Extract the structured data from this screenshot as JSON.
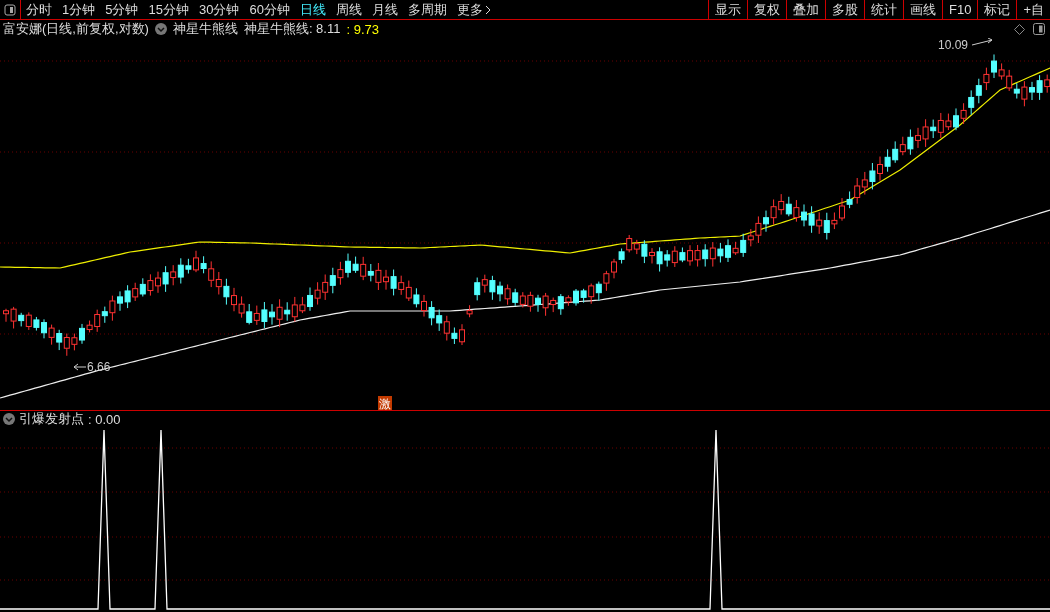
{
  "toolbar": {
    "periods": [
      {
        "label": "分时",
        "selected": false
      },
      {
        "label": "1分钟",
        "selected": false
      },
      {
        "label": "5分钟",
        "selected": false
      },
      {
        "label": "15分钟",
        "selected": false
      },
      {
        "label": "30分钟",
        "selected": false
      },
      {
        "label": "60分钟",
        "selected": false
      },
      {
        "label": "日线",
        "selected": true
      },
      {
        "label": "周线",
        "selected": false
      },
      {
        "label": "月线",
        "selected": false
      },
      {
        "label": "多周期",
        "selected": false
      },
      {
        "label": "更多",
        "selected": false
      }
    ],
    "buttons": [
      "显示",
      "复权",
      "叠加",
      "多股",
      "统计",
      "画线",
      "F10",
      "标记",
      "+自"
    ]
  },
  "main_chart": {
    "title": "富安娜(日线,前复权,对数)",
    "indicator": "神星牛熊线",
    "reading_label": "神星牛熊线: 8.11",
    "reading_value": ": 9.73",
    "high_label": "10.09",
    "low_label": "6.66",
    "signal_marker": "激"
  },
  "sub_chart": {
    "indicator": "引爆发射点",
    "reading": ": 0.00"
  }
}
